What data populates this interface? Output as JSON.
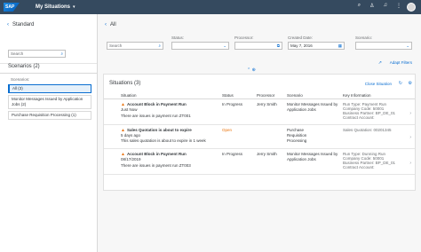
{
  "shell": {
    "logo": "SAP",
    "title": "My Situations",
    "chevron": "▾",
    "icons": [
      "search-icon",
      "person-icon",
      "bell-icon",
      "grid-icon"
    ]
  },
  "left": {
    "back": "‹",
    "title": "Standard",
    "search_placeholder": "Search",
    "scenarios_title": "Scenarios (2)",
    "scenarios_label": "Scenarios:",
    "items": [
      "All (3)",
      "Monitor Messages Issued by Application Jobs (2)",
      "Purchase Requisition Processing (1)"
    ]
  },
  "main": {
    "back": "‹",
    "title": "All",
    "filters": {
      "search_placeholder": "Search",
      "status_label": "Status:",
      "processor_label": "Processor:",
      "created_label": "Created Date:",
      "created_value": "May 7, 2016",
      "scenario_label": "Scenario:"
    },
    "adapt_filters": "Adapt Filters",
    "card": {
      "title": "Situations (3)",
      "close": "Close Situation",
      "columns": [
        "Situation",
        "Status",
        "Processor",
        "Scenario",
        "Key Information"
      ],
      "rows": [
        {
          "title": "Account Block in Payment Run",
          "time": "Just Now",
          "desc": "There are issues in payment run ZT001",
          "status": "In Progress",
          "processor": "Jerry Smith",
          "scenario": "Monitor Messages Issued by Application Jobs",
          "key": [
            "Run Type: Payment Run",
            "Company Code: 50001",
            "Business Partner: BP_DE_01",
            "Contract Account:"
          ]
        },
        {
          "title": "Sales Quotation is about to expire",
          "time": "5 days ago",
          "desc": "This sales quotation is about to expire in 1 week",
          "status": "Open",
          "processor": "",
          "scenario": "Purchase Requisition Processing",
          "key": [
            "Sales Quotation: 00201345"
          ]
        },
        {
          "title": "Account Block in Payment Run",
          "time": "08/17/2019",
          "desc": "There are issues in payment run ZT003",
          "status": "In Progress",
          "processor": "Jerry Smith",
          "scenario": "Monitor Messages Issued by Application Jobs",
          "key": [
            "Run Type: Dunning Run",
            "Company Code: 50001",
            "Business Partner: BP_DE_01",
            "Contract Account:"
          ]
        }
      ]
    }
  }
}
